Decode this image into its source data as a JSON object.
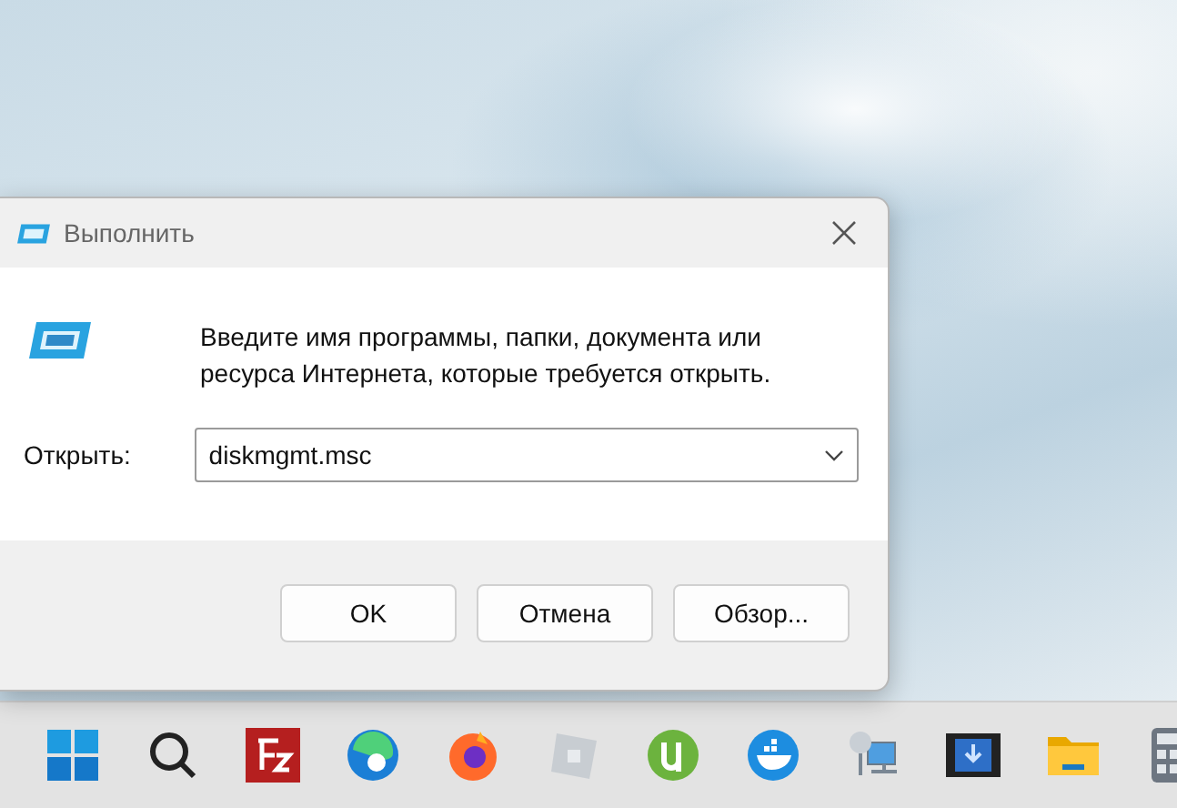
{
  "window": {
    "title": "Выполнить"
  },
  "prompt": "Введите имя программы, папки, документа или ресурса Интернета, которые требуется открыть.",
  "open_field": {
    "label": "Открыть:",
    "value": "diskmgmt.msc"
  },
  "buttons": [
    {
      "label": "OK"
    },
    {
      "label": "Отмена"
    },
    {
      "label": "Обзор..."
    }
  ],
  "taskbar": {
    "items": [
      {
        "kind": "start"
      },
      {
        "kind": "search"
      },
      {
        "kind": "ftp"
      },
      {
        "kind": "edge"
      },
      {
        "kind": "firefox"
      },
      {
        "kind": "cube"
      },
      {
        "kind": "torrent"
      },
      {
        "kind": "whale"
      },
      {
        "kind": "network"
      },
      {
        "kind": "video"
      },
      {
        "kind": "folder"
      },
      {
        "kind": "calculator"
      }
    ]
  }
}
